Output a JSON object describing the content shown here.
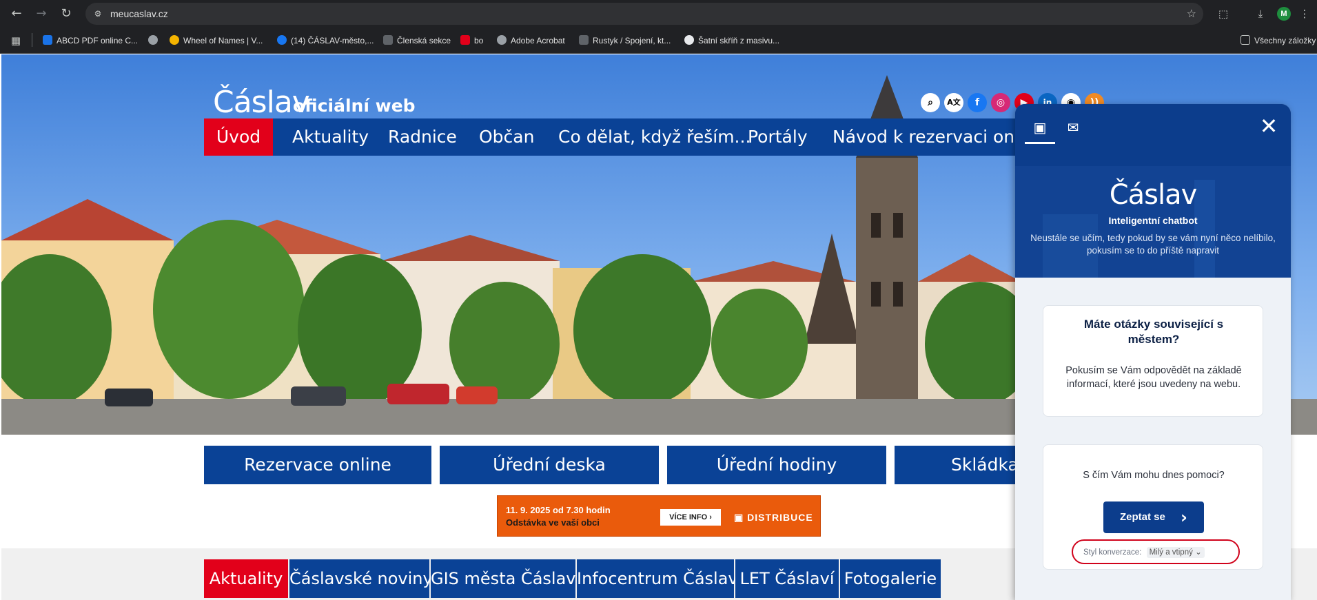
{
  "browser": {
    "url": "meucaslav.cz",
    "profile_initial": "M",
    "bookmarks": [
      {
        "label": "ABCD PDF online C...",
        "color": "#1a73e8"
      },
      {
        "label": "",
        "color": "#9aa0a6"
      },
      {
        "label": "Wheel of Names | V...",
        "color": "#f4b400"
      },
      {
        "label": "(14) ČÁSLAV-město,...",
        "color": "#1877f2"
      },
      {
        "label": "Členská sekce",
        "color": "#5f6368"
      },
      {
        "label": "bo",
        "color": "#e2001a"
      },
      {
        "label": "Adobe Acrobat",
        "color": "#9aa0a6"
      },
      {
        "label": "Rustyk / Spojení, kt...",
        "color": "#5f6368"
      },
      {
        "label": "Šatní skříň z masivu...",
        "color": "#e8eaed"
      }
    ],
    "all_bookmarks": "Všechny záložky"
  },
  "site": {
    "logo": "Čáslav",
    "logo_sub": "oficiální web",
    "nav": [
      "Úvod",
      "Aktuality",
      "Radnice",
      "Občan",
      "Co dělat, když řeším...",
      "Portály",
      "Návod k rezervaci online"
    ],
    "quick_links": [
      "Rezervace online",
      "Úřední deska",
      "Úřední hodiny",
      "Skládka Č"
    ],
    "banner": {
      "line1": "11. 9. 2025 od 7.30 hodin",
      "line2": "Odstávka ve vaší obci",
      "button": "VÍCE INFO",
      "brand": "DISTRIBUCE"
    },
    "tabs": [
      "Aktuality",
      "Čáslavské noviny",
      "GIS města Čáslav",
      "Infocentrum Čáslav",
      "LET Čáslaví",
      "Fotogalerie"
    ]
  },
  "chatbot": {
    "logo": "Čáslav",
    "title": "Inteligentní chatbot",
    "subtitle": "Neustále se učím, tedy pokud by se vám nyní něco nelíbilo, pokusím se to do příště napravit",
    "card_question": "Máte otázky související s městem?",
    "card_answer": "Pokusím se Vám odpovědět na základě informací, které jsou uvedeny na webu.",
    "help_text": "S čím Vám mohu dnes pomoci?",
    "ask_button": "Zeptat se",
    "style_label": "Styl konverzace:",
    "style_value": "Milý a vtipný"
  }
}
